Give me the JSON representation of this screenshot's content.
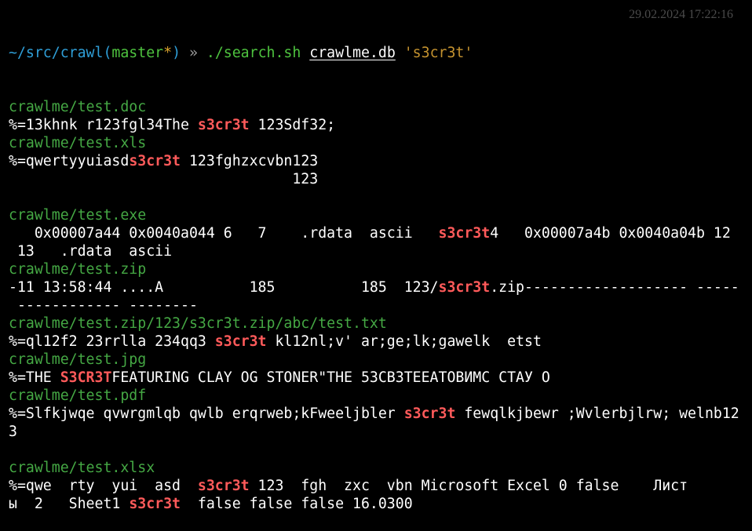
{
  "colors": {
    "background": "#000000",
    "path": "#2f9fd8",
    "branch": "#4ec33f",
    "dirty_marker": "#e0a62e",
    "file_header": "#45a844",
    "match_highlight": "#ff5a5a",
    "timestamp": "#4a4a4a"
  },
  "prompt": {
    "path": "~/src/crawl",
    "open_paren": "(",
    "branch": "master",
    "dirty": "*",
    "close_paren": ")",
    "arrow": " » ",
    "command": "./search.sh",
    "arg1": "crawlme.db",
    "arg2": "'s3cr3t'",
    "timestamp": "29.02.2024 17:22:16"
  },
  "results": [
    {
      "file": "crawlme/test.doc",
      "lines": [
        [
          "%=13khnk r123fgl34The ",
          "s3cr3t",
          " 123Sdf32;"
        ]
      ]
    },
    {
      "file": "crawlme/test.xls",
      "lines": [
        [
          "%=qwertyyuiasd",
          "s3cr3t",
          " 123fghzxcvbn123"
        ],
        [
          "                                 123"
        ],
        [
          ""
        ]
      ]
    },
    {
      "file": "crawlme/test.exe",
      "lines": [
        [
          "   0x00007a44 0x0040a044 6   7    .rdata  ascii   ",
          "s3cr3t",
          "4   0x00007a4b 0x0040a04b 12"
        ],
        [
          " 13   .rdata  ascii"
        ]
      ]
    },
    {
      "file": "crawlme/test.zip",
      "lines": [
        [
          "-11 13:58:44 ....A          185          185  123/",
          "s3cr3t",
          ".zip------------------- -----"
        ],
        [
          " ------------ --------"
        ]
      ]
    },
    {
      "file": "crawlme/test.zip/123/s3cr3t.zip/abc/test.txt",
      "lines": [
        [
          "%=ql12f2 23rrlla 234qq3 ",
          "s3cr3t",
          " kl12nl;v' ar;ge;lk;gawelk  etst"
        ]
      ]
    },
    {
      "file": "crawlme/test.jpg",
      "lines": [
        [
          "%=THE ",
          "S3CR3T",
          "FEATURING CLAY OG STONER\"THE 53CB3TEEATOBИMC CTAУ O"
        ]
      ]
    },
    {
      "file": "crawlme/test.pdf",
      "lines": [
        [
          "%=Slfkjwqe qvwrgmlqb qwlb erqrweb;kFweeljbler ",
          "s3cr3t",
          " fewqlkjbewr ;Wvlerbjlrw; welnb12"
        ],
        [
          "3"
        ],
        [
          ""
        ]
      ]
    },
    {
      "file": "crawlme/test.xlsx",
      "lines": [
        [
          "%=qwe  rty  yui  asd  ",
          "s3cr3t",
          " 123  fgh  zxc  vbn Microsoft Excel 0 false    Лист"
        ],
        [
          "ы  2   Sheet1 ",
          "s3cr3t",
          "  false false false 16.0300"
        ]
      ]
    }
  ]
}
